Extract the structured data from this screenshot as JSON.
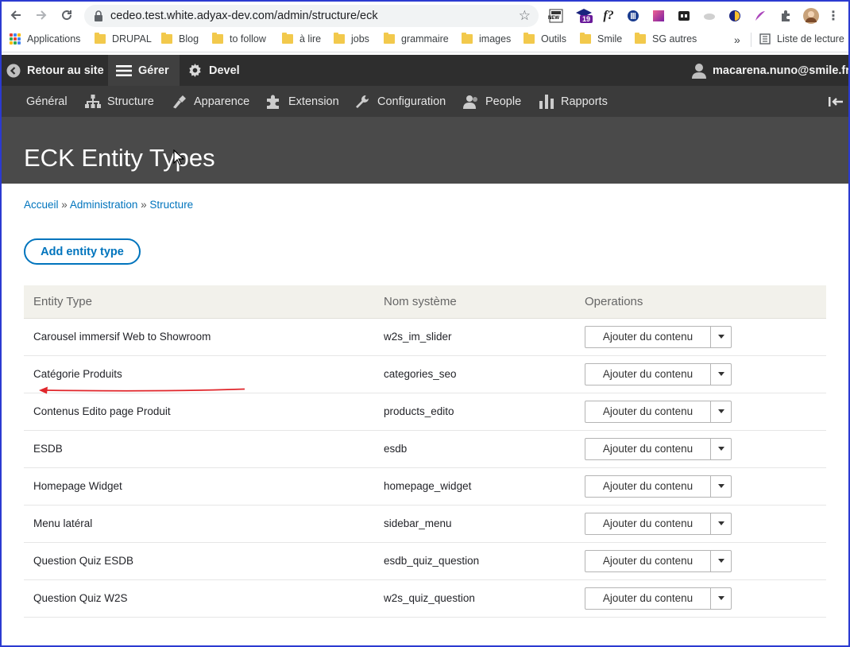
{
  "browser": {
    "url": "cedeo.test.white.adyax-dev.com/admin/structure/eck",
    "bookmarks": [
      "Applications",
      "DRUPAL",
      "Blog",
      "to follow",
      "à lire",
      "jobs",
      "grammaire",
      "images",
      "Outils",
      "Smile",
      "SG autres"
    ],
    "overflow": "»",
    "reading_list": "Liste de lecture",
    "ext_badge": "19",
    "ext_new": "NEW",
    "ext_f": "f?"
  },
  "toolbar": {
    "back_to_site": "Retour au site",
    "manage": "Gérer",
    "devel": "Devel",
    "user": "macarena.nuno@smile.fr"
  },
  "tray": {
    "items": [
      "Général",
      "Structure",
      "Apparence",
      "Extension",
      "Configuration",
      "People",
      "Rapports"
    ]
  },
  "page": {
    "title": "ECK Entity Types",
    "breadcrumb": [
      "Accueil",
      "Administration",
      "Structure"
    ],
    "breadcrumb_sep": "»",
    "add_button": "Add entity type"
  },
  "table": {
    "headers": [
      "Entity Type",
      "Nom système",
      "Operations"
    ],
    "rows": [
      {
        "label": "Carousel immersif Web to Showroom",
        "machine": "w2s_im_slider",
        "op": "Ajouter du contenu"
      },
      {
        "label": "Catégorie Produits",
        "machine": "categories_seo",
        "op": "Ajouter du contenu"
      },
      {
        "label": "Contenus Edito page Produit",
        "machine": "products_edito",
        "op": "Ajouter du contenu"
      },
      {
        "label": "ESDB",
        "machine": "esdb",
        "op": "Ajouter du contenu"
      },
      {
        "label": "Homepage Widget",
        "machine": "homepage_widget",
        "op": "Ajouter du contenu"
      },
      {
        "label": "Menu latéral",
        "machine": "sidebar_menu",
        "op": "Ajouter du contenu"
      },
      {
        "label": "Question Quiz ESDB",
        "machine": "esdb_quiz_question",
        "op": "Ajouter du contenu"
      },
      {
        "label": "Question Quiz W2S",
        "machine": "w2s_quiz_question",
        "op": "Ajouter du contenu"
      }
    ]
  },
  "colors": {
    "link": "#0074bd",
    "toolbar_bg": "#2e2e2e",
    "tray_bg": "#3b3b3b",
    "header_bg": "#4a4a4a",
    "annotation_arrow": "#e0262b"
  }
}
